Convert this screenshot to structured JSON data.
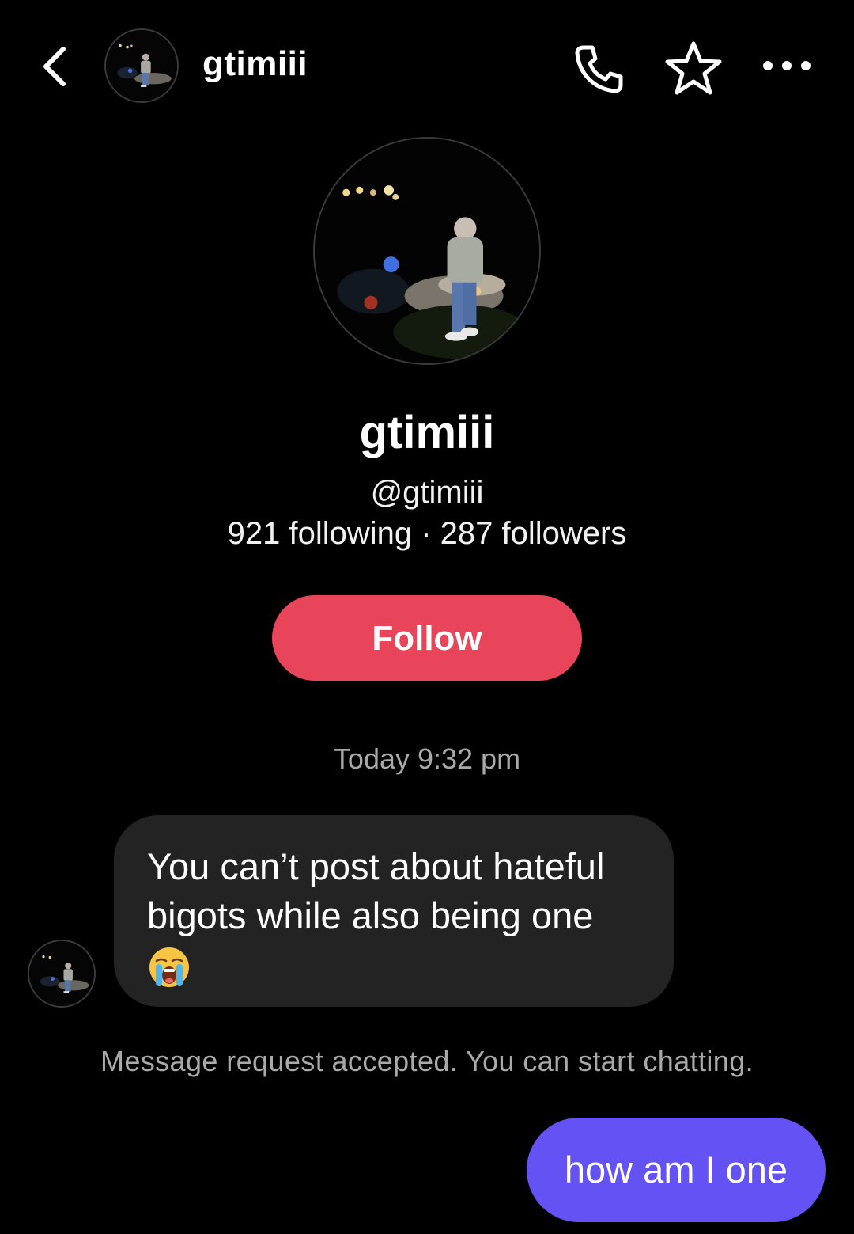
{
  "header": {
    "username": "gtimiii",
    "icons": [
      "back-chevron-icon",
      "phone-icon",
      "star-icon",
      "more-dots-icon"
    ]
  },
  "profile": {
    "display_name": "gtimiii",
    "handle": "@gtimiii",
    "stats": "921 following · 287 followers",
    "follow_label": "Follow"
  },
  "chat": {
    "timestamp": "Today 9:32 pm",
    "incoming_message": "You can’t post about hateful bigots while also being one",
    "incoming_emoji": "loudly-crying-face-icon",
    "system_note": "Message request accepted. You can start chatting.",
    "outgoing_message": "how am I one"
  },
  "colors": {
    "background": "#000000",
    "follow_button": "#e8445a",
    "outgoing_bubble": "#6452f4",
    "incoming_bubble": "#232323",
    "muted_text": "#a9a9a9"
  }
}
